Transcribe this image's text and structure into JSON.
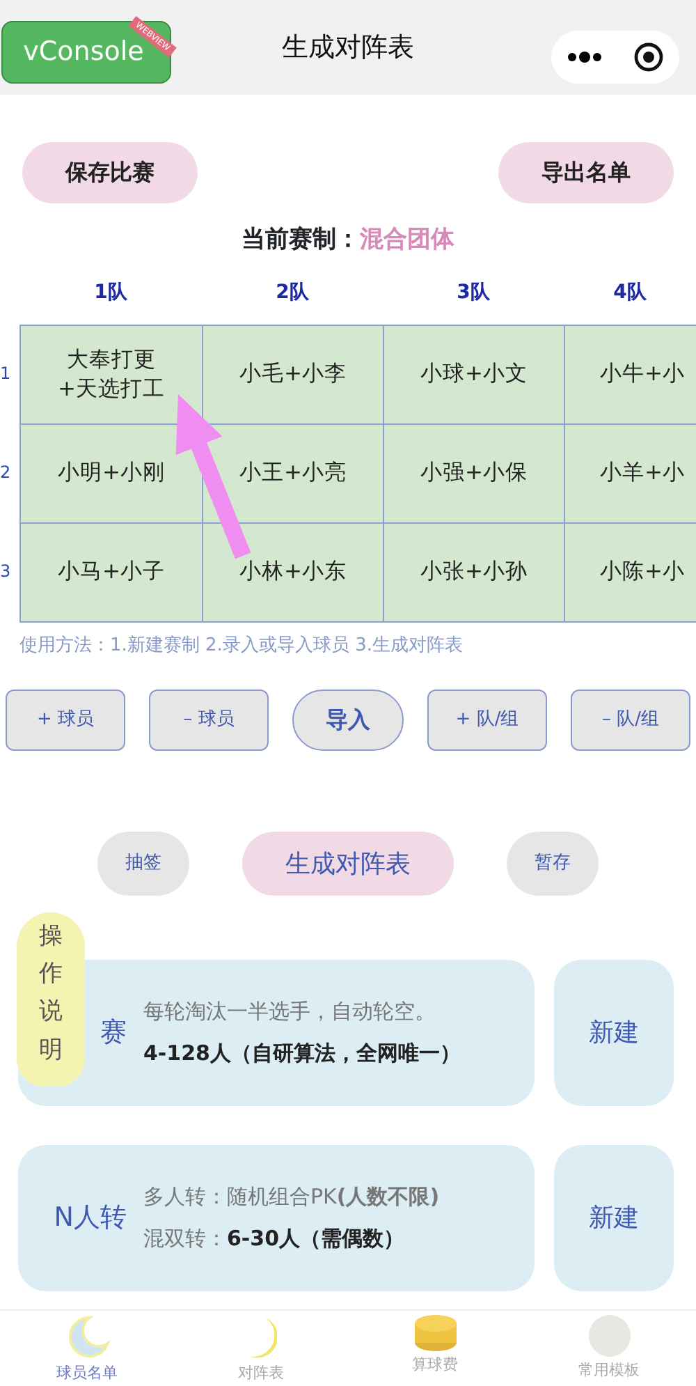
{
  "vconsole": {
    "label": "vConsole",
    "ribbon": "WEBVIEW"
  },
  "nav": {
    "title": "生成对阵表"
  },
  "top_buttons": [
    "保存比赛",
    "导出名单"
  ],
  "format": {
    "label": "当前赛制：",
    "value": "混合团体"
  },
  "table": {
    "columns": [
      "1队",
      "2队",
      "3队",
      "4队"
    ],
    "rows": [
      {
        "number": "1",
        "cells": [
          "大奉打更\n+天选打工",
          "小毛+小李",
          "小球+小文",
          "小牛+小"
        ]
      },
      {
        "number": "2",
        "cells": [
          "小明+小刚",
          "小王+小亮",
          "小强+小保",
          "小羊+小"
        ]
      },
      {
        "number": "3",
        "cells": [
          "小马+小子",
          "小林+小东",
          "小张+小孙",
          "小陈+小"
        ]
      }
    ]
  },
  "usage": "使用方法：1.新建赛制   2.录入或导入球员   3.生成对阵表",
  "tools": [
    {
      "label": "+ 球员",
      "kind": "square"
    },
    {
      "label": "– 球员",
      "kind": "square"
    },
    {
      "label": "导入",
      "kind": "round"
    },
    {
      "label": "+ 队/组",
      "kind": "square"
    },
    {
      "label": "– 队/组",
      "kind": "square"
    }
  ],
  "actions": [
    {
      "label": "抽签",
      "kind": "grey"
    },
    {
      "label": "生成对阵表",
      "kind": "pink"
    },
    {
      "label": "暂存",
      "kind": "grey"
    }
  ],
  "help_note": "操作说明",
  "formats": [
    {
      "title": "赛",
      "lines": [
        {
          "text": "每轮淘汰一半选手，自动轮空。",
          "bold": false
        },
        {
          "text": "4-128人（自研算法，全网唯一）",
          "bold": true
        }
      ],
      "button": "新建"
    },
    {
      "title": "N人转",
      "lines": [
        {
          "label": "多人转：",
          "text": "随机组合PK**(人数不限)**",
          "bold": false
        },
        {
          "label": "混双转：",
          "text": "6-30人（需偶数）",
          "bold": true
        }
      ],
      "button": "新建"
    }
  ],
  "tabbar": [
    {
      "label": "球员名单",
      "selected": true
    },
    {
      "label": "对阵表",
      "selected": false
    },
    {
      "label": "算球费",
      "selected": false
    },
    {
      "label": "常用模板",
      "selected": false
    }
  ]
}
